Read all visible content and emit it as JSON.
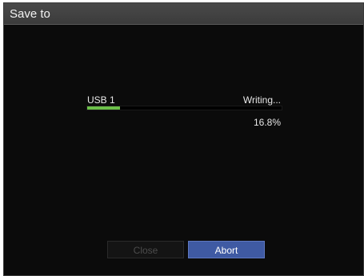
{
  "dialog": {
    "title": "Save to"
  },
  "transfer": {
    "device": "USB 1",
    "status": "Writing...",
    "progress_fraction": 0.168,
    "percent_text": "16.8%",
    "progress_color": "#6cc04a"
  },
  "buttons": {
    "close_label": "Close",
    "close_enabled": false,
    "abort_label": "Abort",
    "abort_color": "#3f5aa3"
  }
}
